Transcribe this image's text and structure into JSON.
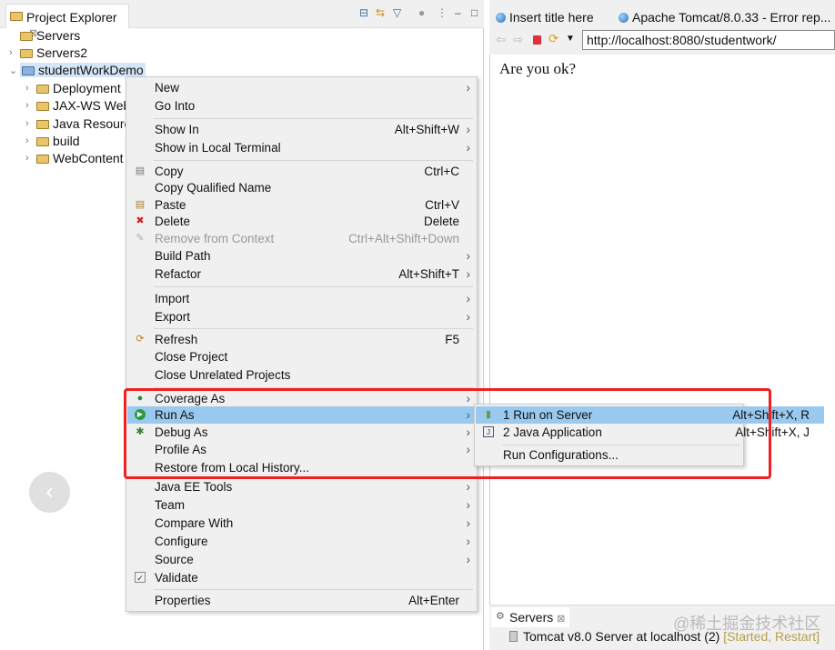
{
  "project_explorer": {
    "title": "Project Explorer",
    "close": "⊠",
    "tree": [
      {
        "label": "Servers",
        "expanded": null
      },
      {
        "label": "Servers2",
        "expanded": false
      },
      {
        "label": "studentWorkDemo",
        "expanded": true,
        "selected": true
      },
      {
        "label": "Deployment",
        "expanded": false
      },
      {
        "label": "JAX-WS Web",
        "expanded": false
      },
      {
        "label": "Java Resourc",
        "expanded": false
      },
      {
        "label": "build",
        "expanded": false
      },
      {
        "label": "WebContent",
        "expanded": false
      }
    ]
  },
  "browser": {
    "tabs": [
      "Insert title here",
      "Apache Tomcat/8.0.33 - Error rep..."
    ],
    "url": "http://localhost:8080/studentwork/",
    "content": "Are you ok?"
  },
  "context_menu": {
    "items": [
      {
        "label": "New",
        "shortcut": "",
        "submenu": true
      },
      {
        "label": "Go Into",
        "shortcut": ""
      },
      {
        "label": "Show In",
        "shortcut": "Alt+Shift+W",
        "submenu": true
      },
      {
        "label": "Show in Local Terminal",
        "shortcut": "",
        "submenu": true
      },
      {
        "label": "Copy",
        "shortcut": "Ctrl+C",
        "icon": "copy-icon"
      },
      {
        "label": "Copy Qualified Name",
        "shortcut": ""
      },
      {
        "label": "Paste",
        "shortcut": "Ctrl+V",
        "icon": "paste-icon"
      },
      {
        "label": "Delete",
        "shortcut": "Delete",
        "icon": "delete-icon"
      },
      {
        "label": "Remove from Context",
        "shortcut": "Ctrl+Alt+Shift+Down",
        "disabled": true,
        "icon": "remove-context-icon"
      },
      {
        "label": "Build Path",
        "shortcut": "",
        "submenu": true
      },
      {
        "label": "Refactor",
        "shortcut": "Alt+Shift+T",
        "submenu": true
      },
      {
        "label": "Import",
        "shortcut": "",
        "submenu": true
      },
      {
        "label": "Export",
        "shortcut": "",
        "submenu": true
      },
      {
        "label": "Refresh",
        "shortcut": "F5",
        "icon": "refresh-icon"
      },
      {
        "label": "Close Project",
        "shortcut": ""
      },
      {
        "label": "Close Unrelated Projects",
        "shortcut": ""
      },
      {
        "label": "Coverage As",
        "shortcut": "",
        "submenu": true,
        "icon": "coverage-icon"
      },
      {
        "label": "Run As",
        "shortcut": "",
        "submenu": true,
        "highlighted": true,
        "icon": "run-icon"
      },
      {
        "label": "Debug As",
        "shortcut": "",
        "submenu": true,
        "icon": "debug-icon"
      },
      {
        "label": "Profile As",
        "shortcut": "",
        "submenu": true
      },
      {
        "label": "Restore from Local History...",
        "shortcut": ""
      },
      {
        "label": "Java EE Tools",
        "shortcut": "",
        "submenu": true
      },
      {
        "label": "Team",
        "shortcut": "",
        "submenu": true
      },
      {
        "label": "Compare With",
        "shortcut": "",
        "submenu": true
      },
      {
        "label": "Configure",
        "shortcut": "",
        "submenu": true
      },
      {
        "label": "Source",
        "shortcut": "",
        "submenu": true
      },
      {
        "label": "Validate",
        "shortcut": "",
        "icon": "checkbox-checked-icon"
      },
      {
        "label": "Properties",
        "shortcut": "Alt+Enter"
      }
    ]
  },
  "run_as_submenu": {
    "items": [
      {
        "label": "1 Run on Server",
        "shortcut": "Alt+Shift+X, R",
        "highlighted": true,
        "icon": "server-run-icon"
      },
      {
        "label": "2 Java Application",
        "shortcut": "Alt+Shift+X, J",
        "icon": "java-app-icon"
      },
      {
        "label": "Run Configurations...",
        "shortcut": ""
      }
    ]
  },
  "servers_view": {
    "title": "Servers",
    "close": "⊠",
    "server": "Tomcat v8.0 Server at localhost (2)",
    "status": "[Started, Restart]"
  },
  "watermark": "@稀土掘金技术社区",
  "colors": {
    "highlight": "#99c9ef",
    "annotation": "#f02020"
  }
}
